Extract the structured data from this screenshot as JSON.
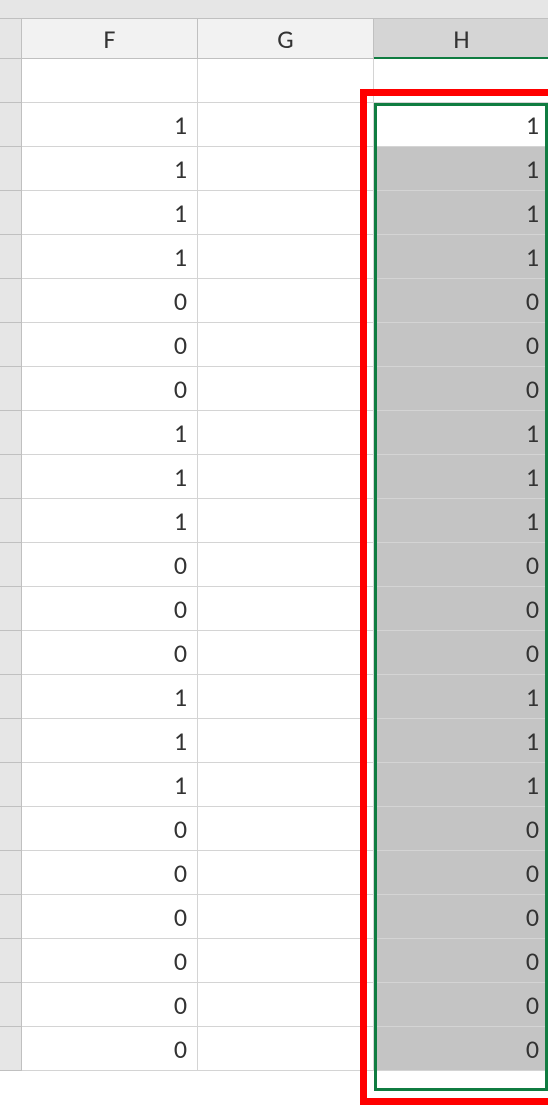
{
  "columns": [
    {
      "label": "F",
      "selected": false
    },
    {
      "label": "G",
      "selected": false
    },
    {
      "label": "H",
      "selected": true
    }
  ],
  "rows": [
    {
      "F": "",
      "G": "",
      "H": ""
    },
    {
      "F": "1",
      "G": "",
      "H": "1"
    },
    {
      "F": "1",
      "G": "",
      "H": "1"
    },
    {
      "F": "1",
      "G": "",
      "H": "1"
    },
    {
      "F": "1",
      "G": "",
      "H": "1"
    },
    {
      "F": "0",
      "G": "",
      "H": "0"
    },
    {
      "F": "0",
      "G": "",
      "H": "0"
    },
    {
      "F": "0",
      "G": "",
      "H": "0"
    },
    {
      "F": "1",
      "G": "",
      "H": "1"
    },
    {
      "F": "1",
      "G": "",
      "H": "1"
    },
    {
      "F": "1",
      "G": "",
      "H": "1"
    },
    {
      "F": "0",
      "G": "",
      "H": "0"
    },
    {
      "F": "0",
      "G": "",
      "H": "0"
    },
    {
      "F": "0",
      "G": "",
      "H": "0"
    },
    {
      "F": "1",
      "G": "",
      "H": "1"
    },
    {
      "F": "1",
      "G": "",
      "H": "1"
    },
    {
      "F": "1",
      "G": "",
      "H": "1"
    },
    {
      "F": "0",
      "G": "",
      "H": "0"
    },
    {
      "F": "0",
      "G": "",
      "H": "0"
    },
    {
      "F": "0",
      "G": "",
      "H": "0"
    },
    {
      "F": "0",
      "G": "",
      "H": "0"
    },
    {
      "F": "0",
      "G": "",
      "H": "0"
    },
    {
      "F": "0",
      "G": "",
      "H": "0"
    }
  ],
  "selection": {
    "col": "H",
    "startRow": 1,
    "activeRow": 1
  }
}
